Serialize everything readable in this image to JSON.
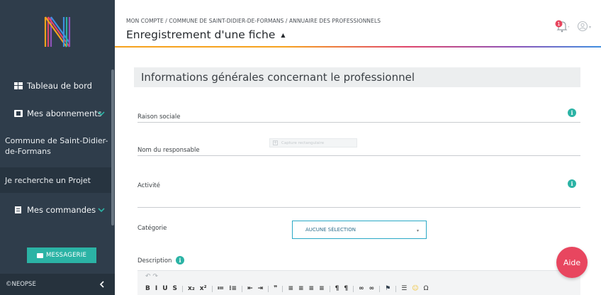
{
  "app": {
    "logo_letter": "N"
  },
  "header": {
    "breadcrumb": "MON COMPTE / COMMUNE DE SAINT-DIDIER-DE-FORMANS / ANNUAIRE DES PROFESSIONNELS",
    "title": "Enregistrement d'une fiche",
    "notification_count": "1"
  },
  "sidebar": {
    "items": [
      {
        "label": "Tableau de bord",
        "icon": "dashboard-icon"
      },
      {
        "label": "Mes abonnements",
        "icon": "subscriptions-icon"
      },
      {
        "label": "Commune de Saint-Didier-de-Formans"
      },
      {
        "label": "Je recherche un Projet"
      },
      {
        "label": "Mes commandes",
        "icon": "orders-icon"
      }
    ],
    "messaging_label": "MESSAGERIE",
    "footer_label": "©NEOPSE"
  },
  "form": {
    "section_title": "Informations générales concernant le professionnel",
    "fields": {
      "raison_sociale": {
        "label": "Raison sociale",
        "value": ""
      },
      "nom_responsable": {
        "label": "Nom du responsable",
        "value": ""
      },
      "activite": {
        "label": "Activité",
        "value": ""
      },
      "categorie": {
        "label": "Catégorie",
        "selected": "AUCUNE SÉLECTION"
      },
      "description": {
        "label": "Description"
      }
    },
    "capture_hint": "Capture rectangulaire"
  },
  "editor": {
    "undo_redo": "↶ ↷",
    "buttons": [
      "B",
      "I",
      "U",
      "S",
      "x₂",
      "x²",
      "≔",
      "⁝≡",
      "⇤",
      "⇥",
      "❞",
      "≡",
      "≡",
      "≡",
      "≡",
      "¶",
      "¶",
      "∞",
      "∞",
      "⚑",
      "☰",
      "☺",
      "Ω"
    ]
  },
  "help": {
    "label": "Aide"
  },
  "colors": {
    "sidebar": "#2f3d4b",
    "accent_teal": "#2bb3a5",
    "help_red": "#e8465f",
    "notification_red": "#e8465f"
  }
}
